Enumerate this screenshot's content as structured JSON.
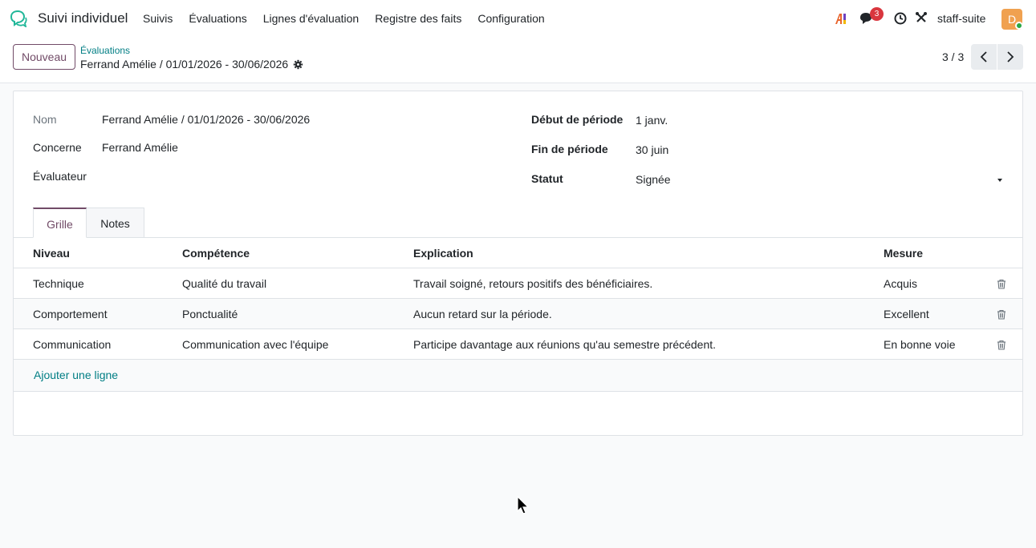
{
  "navbar": {
    "app_name": "Suivi individuel",
    "menu": [
      "Suivis",
      "Évaluations",
      "Lignes d'évaluation",
      "Registre des faits",
      "Configuration"
    ],
    "ai_label": "AI",
    "chat_badge": "3",
    "db_name": "staff-suite",
    "avatar_letter": "D"
  },
  "control": {
    "new_button": "Nouveau",
    "breadcrumb": "Évaluations",
    "record_title": "Ferrand Amélie / 01/01/2026 - 30/06/2026",
    "pager": "3 / 3"
  },
  "form": {
    "nom_label": "Nom",
    "nom_value": "Ferrand Amélie / 01/01/2026 - 30/06/2026",
    "concerne_label": "Concerne",
    "concerne_value": "Ferrand Amélie",
    "evaluateur_label": "Évaluateur",
    "evaluateur_value": "",
    "debut_label": "Début de période",
    "debut_value": "1 janv.",
    "fin_label": "Fin de période",
    "fin_value": "30 juin",
    "statut_label": "Statut",
    "statut_value": "Signée"
  },
  "tabs": [
    "Grille",
    "Notes"
  ],
  "grid": {
    "headers": [
      "Niveau",
      "Compétence",
      "Explication",
      "Mesure"
    ],
    "rows": [
      [
        "Technique",
        "Qualité du travail",
        "Travail soigné, retours positifs des bénéficiaires.",
        "Acquis"
      ],
      [
        "Comportement",
        "Ponctualité",
        "Aucun retard sur la période.",
        "Excellent"
      ],
      [
        "Communication",
        "Communication avec l'équipe",
        "Participe davantage aux réunions qu'au semestre précédent.",
        "En bonne voie"
      ]
    ],
    "add_line": "Ajouter une ligne"
  },
  "colors": {
    "brand": "#714b67",
    "link": "#017e84",
    "badge": "#d9363e"
  }
}
